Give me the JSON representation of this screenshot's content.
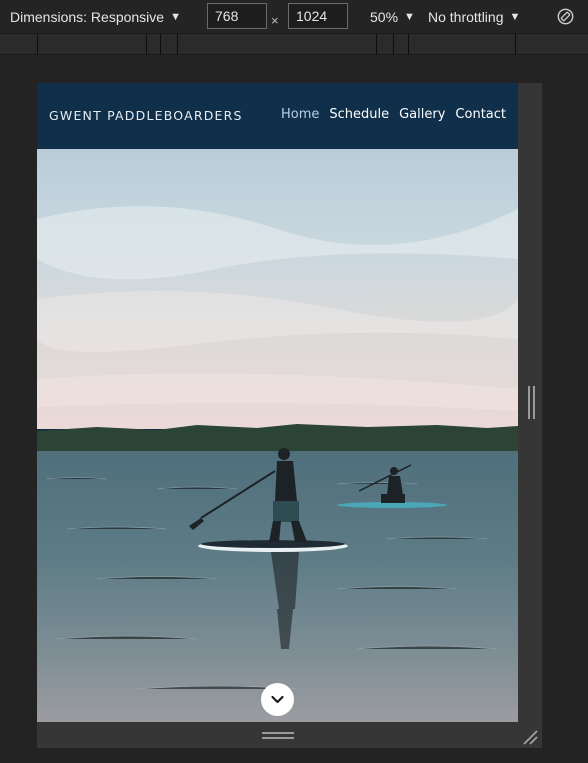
{
  "devtools": {
    "dimensions_label": "Dimensions: Responsive",
    "width_value": "768",
    "height_value": "1024",
    "times_symbol": "×",
    "zoom_label": "50%",
    "throttle_label": "No throttling",
    "caret": "▼",
    "rotate_icon": "rotate-icon"
  },
  "site": {
    "brand": "GWENT PADDLEBOARDERS",
    "nav": [
      {
        "label": "Home",
        "active": true
      },
      {
        "label": "Schedule",
        "active": false
      },
      {
        "label": "Gallery",
        "active": false
      },
      {
        "label": "Contact",
        "active": false
      }
    ],
    "nav_bg": "#0f2f4a",
    "scroll_icon": "chevron-down-icon"
  }
}
